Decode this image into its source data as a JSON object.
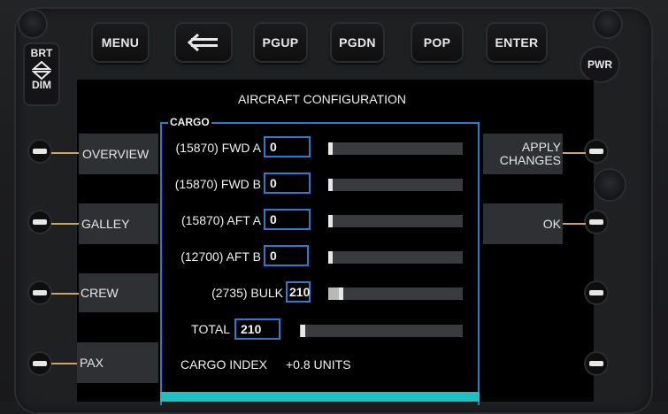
{
  "top_buttons": {
    "menu": "MENU",
    "pgup": "PGUP",
    "pgdn": "PGDN",
    "pop": "POP",
    "enter": "ENTER"
  },
  "brightness": {
    "brt": "BRT",
    "dim": "DIM"
  },
  "power": {
    "label": "PWR"
  },
  "screen": {
    "title": "AIRCRAFT CONFIGURATION"
  },
  "left_menu": [
    {
      "label": "OVERVIEW"
    },
    {
      "label": "GALLEY"
    },
    {
      "label": "CREW"
    },
    {
      "label": "PAX"
    }
  ],
  "right_menu": {
    "apply_line1": "APPLY",
    "apply_line2": "CHANGES",
    "ok": "OK"
  },
  "cargo": {
    "legend": "CARGO",
    "rows": [
      {
        "label": "(15870) FWD A",
        "value": "0",
        "fill_fraction": 0.0
      },
      {
        "label": "(15870) FWD B",
        "value": "0",
        "fill_fraction": 0.0
      },
      {
        "label": "(15870) AFT A",
        "value": "0",
        "fill_fraction": 0.0
      },
      {
        "label": "(12700) AFT B",
        "value": "0",
        "fill_fraction": 0.0
      },
      {
        "label": "(2735) BULK",
        "value": "210",
        "fill_fraction": 0.077
      }
    ],
    "total": {
      "label": "TOTAL",
      "value": "210",
      "fill_fraction": 0.003
    },
    "index": {
      "label": "CARGO INDEX",
      "value": "+0.8 UNITS"
    }
  },
  "colors": {
    "accent_blue": "#2c7bd1",
    "teal": "#1ec0c2",
    "lsk_line": "#c9a56a"
  }
}
